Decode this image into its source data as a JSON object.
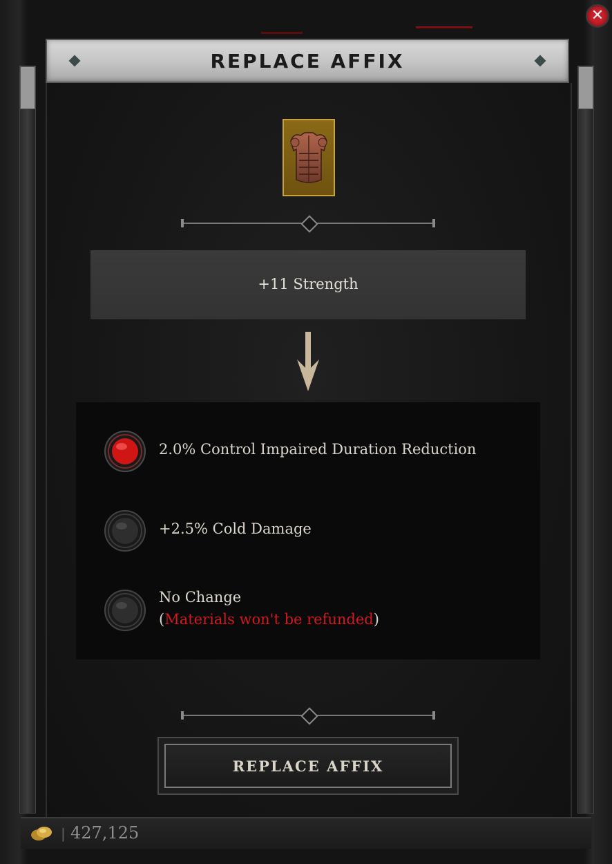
{
  "window": {
    "title": "REPLACE AFFIX",
    "close_icon": "close-icon"
  },
  "item": {
    "icon": "chest-armor-icon",
    "rarity_color": "#c9a240"
  },
  "current_affix": {
    "text": "+11 Strength"
  },
  "options": [
    {
      "text": "2.0% Control Impaired Duration Reduction",
      "selected": true
    },
    {
      "text": "+2.5% Cold Damage",
      "selected": false
    },
    {
      "text": "No Change",
      "note_open": "(",
      "note": "Materials won't be refunded",
      "note_close": ")",
      "selected": false
    }
  ],
  "action_button": {
    "label": "REPLACE AFFIX"
  },
  "currency": {
    "icon": "gold-icon",
    "separator": "|",
    "amount": "427,125"
  },
  "colors": {
    "selected_radio": "#d01515",
    "warning_text": "#d1191e",
    "title_bar": "#c4c4c4"
  }
}
